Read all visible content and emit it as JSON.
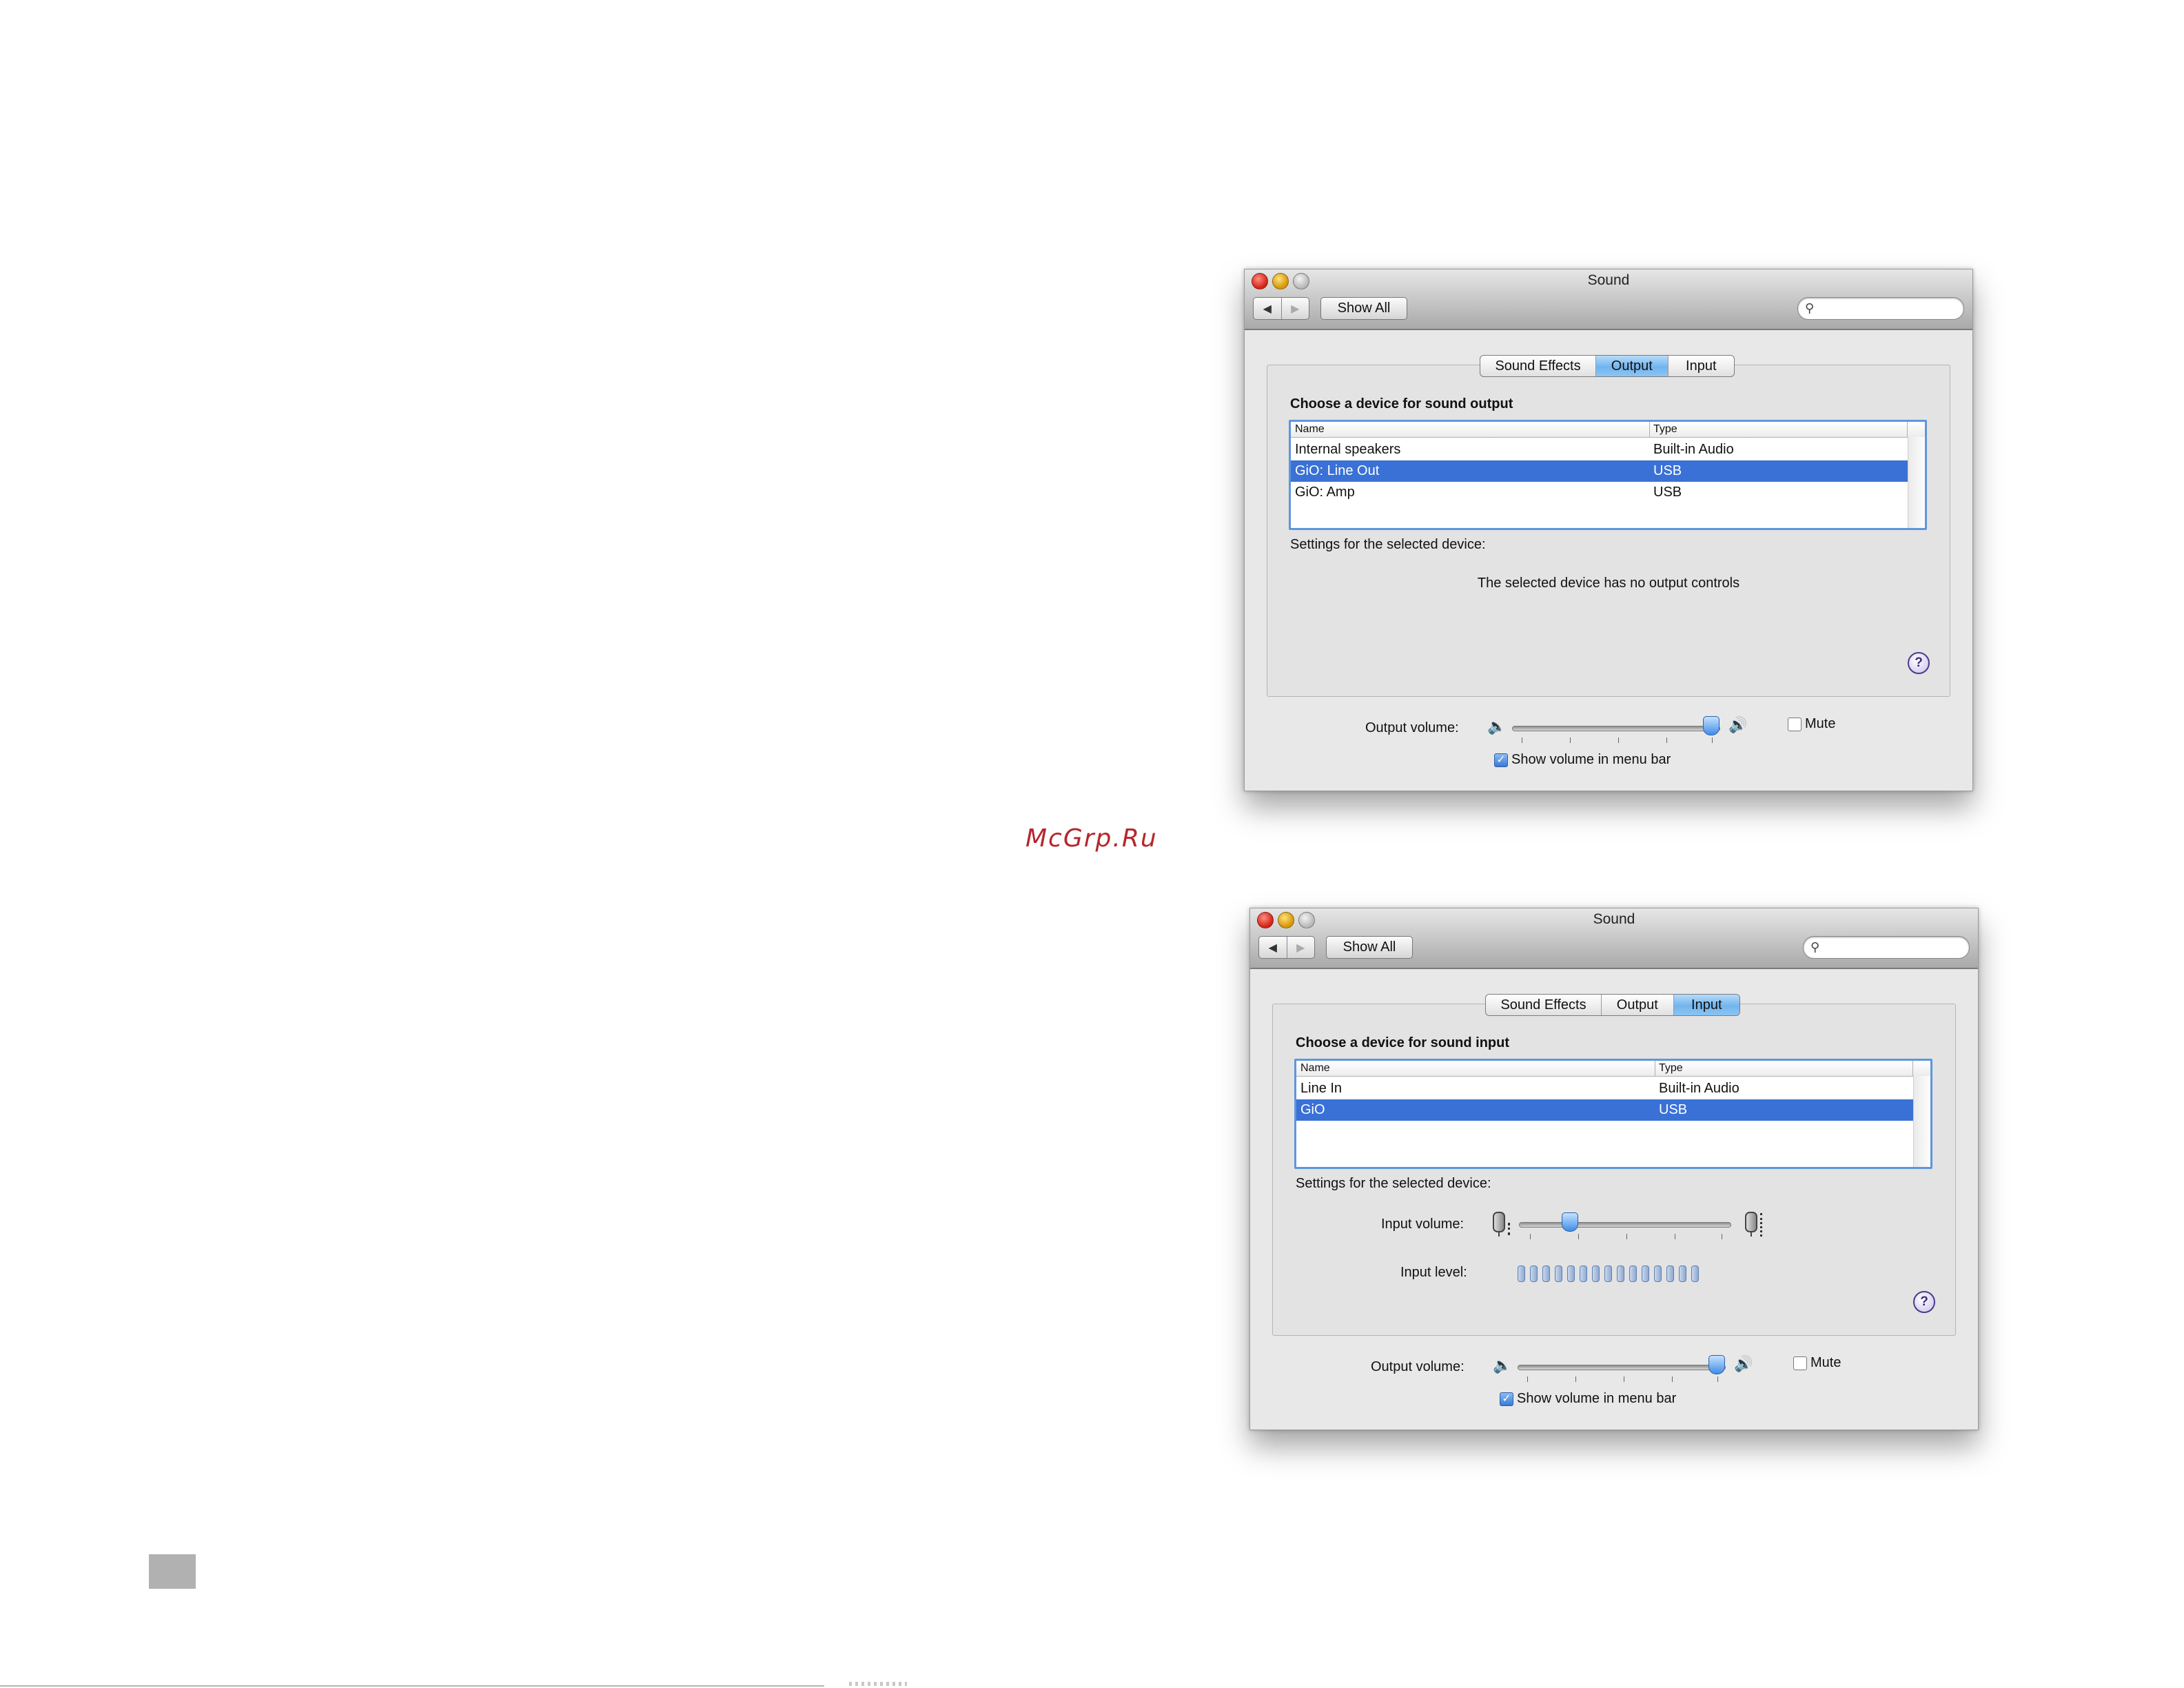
{
  "watermark": "McGrp.Ru",
  "windows": [
    {
      "title": "Sound",
      "show_all": "Show All",
      "nav_back": "◀",
      "nav_forward": "▶",
      "search_placeholder": "",
      "tabs": [
        "Sound Effects",
        "Output",
        "Input"
      ],
      "selected_tab": "Output",
      "section_title": "Choose a device for sound output",
      "columns": [
        "Name",
        "Type"
      ],
      "devices": [
        {
          "name": "Internal speakers",
          "type": "Built-in Audio",
          "selected": false
        },
        {
          "name": "GiO: Line Out",
          "type": "USB",
          "selected": true
        },
        {
          "name": "GiO: Amp",
          "type": "USB",
          "selected": false
        }
      ],
      "settings_label": "Settings for the selected device:",
      "no_controls_message": "The selected device has no output controls",
      "help": "?",
      "output_volume_label": "Output volume:",
      "output_volume_level": 0.96,
      "mute_label": "Mute",
      "mute_checked": false,
      "show_volume_label": "Show volume in menu bar",
      "show_volume_checked": true
    },
    {
      "title": "Sound",
      "show_all": "Show All",
      "nav_back": "◀",
      "nav_forward": "▶",
      "search_placeholder": "",
      "tabs": [
        "Sound Effects",
        "Output",
        "Input"
      ],
      "selected_tab": "Input",
      "section_title": "Choose a device for sound input",
      "columns": [
        "Name",
        "Type"
      ],
      "devices": [
        {
          "name": "Line In",
          "type": "Built-in Audio",
          "selected": false
        },
        {
          "name": "GiO",
          "type": "USB",
          "selected": true
        }
      ],
      "settings_label": "Settings for the selected device:",
      "input_volume_label": "Input volume:",
      "input_volume_level": 0.24,
      "input_level_label": "Input level:",
      "input_level_segments": 15,
      "help": "?",
      "output_volume_label": "Output volume:",
      "output_volume_level": 0.96,
      "mute_label": "Mute",
      "mute_checked": false,
      "show_volume_label": "Show volume in menu bar",
      "show_volume_checked": true
    }
  ],
  "colors": {
    "selection": "#3a71d6",
    "tab_selected": "#72b4ee",
    "watermark": "#b5262c"
  }
}
